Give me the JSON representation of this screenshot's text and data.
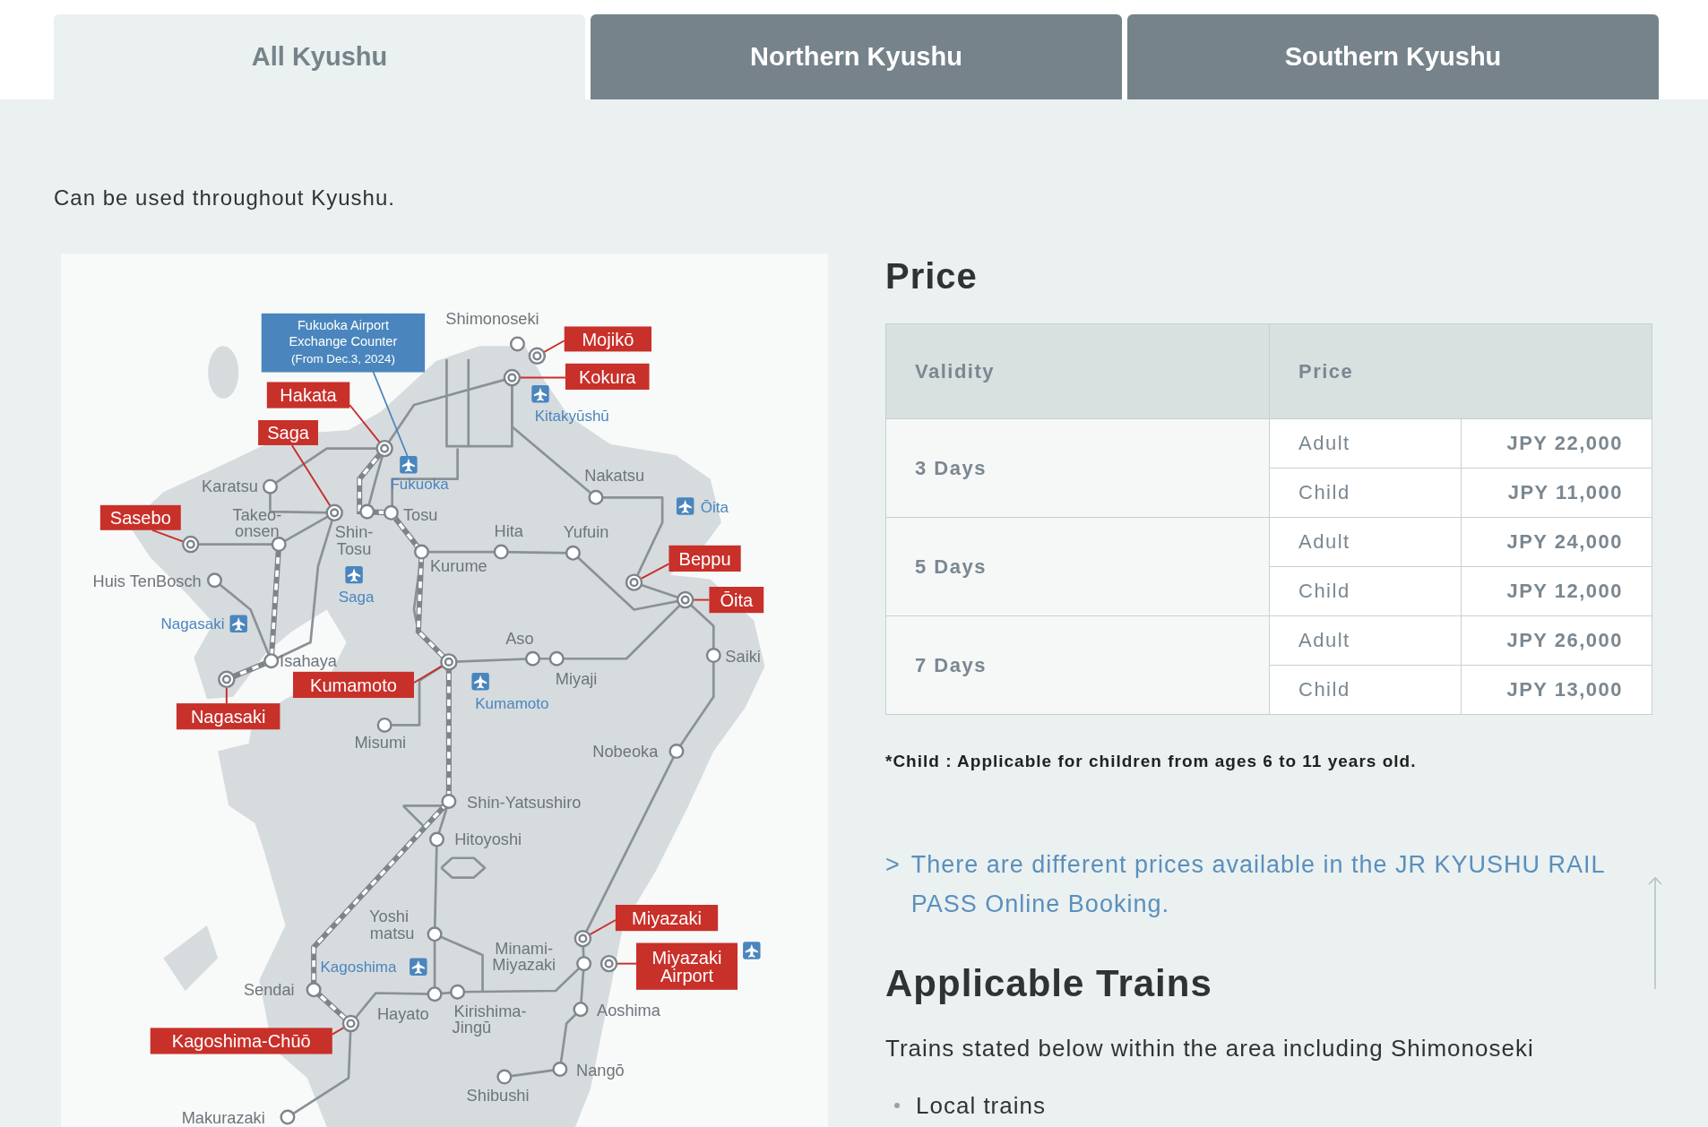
{
  "tabs": [
    {
      "label": "All Kyushu",
      "selected": true
    },
    {
      "label": "Northern Kyushu",
      "selected": false
    },
    {
      "label": "Southern Kyushu",
      "selected": false
    }
  ],
  "intro": "Can be used throughout Kyushu.",
  "map": {
    "callout": {
      "lines": [
        "Fukuoka Airport",
        "Exchange  Counter",
        "(From Dec.3, 2024)"
      ]
    },
    "stations": [
      {
        "kind": "minor",
        "lines": [
          "Shimonoseki"
        ]
      },
      {
        "kind": "major",
        "lines": [
          "Mojikō"
        ]
      },
      {
        "kind": "major",
        "lines": [
          "Kokura"
        ]
      },
      {
        "kind": "major",
        "lines": [
          "Hakata"
        ]
      },
      {
        "kind": "major",
        "lines": [
          "Saga"
        ]
      },
      {
        "kind": "minor",
        "lines": [
          "Karatsu"
        ]
      },
      {
        "kind": "minor",
        "lines": [
          "Nakatsu"
        ]
      },
      {
        "kind": "major",
        "lines": [
          "Sasebo"
        ]
      },
      {
        "kind": "minor",
        "lines": [
          "Takeo-",
          "onsen"
        ]
      },
      {
        "kind": "minor",
        "lines": [
          "Tosu"
        ]
      },
      {
        "kind": "minor",
        "lines": [
          "Shin-",
          "Tosu"
        ]
      },
      {
        "kind": "minor",
        "lines": [
          "Hita"
        ]
      },
      {
        "kind": "minor",
        "lines": [
          "Yufuin"
        ]
      },
      {
        "kind": "major",
        "lines": [
          "Beppu"
        ]
      },
      {
        "kind": "minor",
        "lines": [
          "Huis TenBosch"
        ]
      },
      {
        "kind": "minor",
        "lines": [
          "Kurume"
        ]
      },
      {
        "kind": "major",
        "lines": [
          "Ōita"
        ]
      },
      {
        "kind": "minor",
        "lines": [
          "Aso"
        ]
      },
      {
        "kind": "minor",
        "lines": [
          "Saiki"
        ]
      },
      {
        "kind": "minor",
        "lines": [
          "Isahaya"
        ]
      },
      {
        "kind": "minor",
        "lines": [
          "Miyaji"
        ]
      },
      {
        "kind": "major",
        "lines": [
          "Kumamoto"
        ]
      },
      {
        "kind": "major",
        "lines": [
          "Nagasaki"
        ]
      },
      {
        "kind": "minor",
        "lines": [
          "Misumi"
        ]
      },
      {
        "kind": "minor",
        "lines": [
          "Nobeoka"
        ]
      },
      {
        "kind": "minor",
        "lines": [
          "Shin-Yatsushiro"
        ]
      },
      {
        "kind": "minor",
        "lines": [
          "Hitoyoshi"
        ]
      },
      {
        "kind": "minor",
        "lines": [
          "Yoshi",
          "matsu"
        ]
      },
      {
        "kind": "major",
        "lines": [
          "Miyazaki"
        ]
      },
      {
        "kind": "minor",
        "lines": [
          "Minami-",
          "Miyazaki"
        ]
      },
      {
        "kind": "major",
        "lines": [
          "Miyazaki",
          "Airport"
        ]
      },
      {
        "kind": "minor",
        "lines": [
          "Sendai"
        ]
      },
      {
        "kind": "minor",
        "lines": [
          "Hayato"
        ]
      },
      {
        "kind": "minor",
        "lines": [
          "Kirishima-",
          "Jingū"
        ]
      },
      {
        "kind": "minor",
        "lines": [
          "Aoshima"
        ]
      },
      {
        "kind": "major",
        "lines": [
          "Kagoshima-Chūō"
        ]
      },
      {
        "kind": "minor",
        "lines": [
          "Nangō"
        ]
      },
      {
        "kind": "minor",
        "lines": [
          "Shibushi"
        ]
      },
      {
        "kind": "minor",
        "lines": [
          "Makurazaki"
        ]
      }
    ],
    "airports": [
      {
        "name": "Kitakyūshū"
      },
      {
        "name": "Fukuoka"
      },
      {
        "name": "Ōita"
      },
      {
        "name": "Saga"
      },
      {
        "name": "Nagasaki"
      },
      {
        "name": "Kumamoto"
      },
      {
        "name": "Kagoshima"
      }
    ]
  },
  "price": {
    "title": "Price",
    "columns": [
      "Validity",
      "Price"
    ],
    "rows": [
      {
        "validity": "3 Days",
        "prices": [
          {
            "type": "Adult",
            "amount": "JPY 22,000"
          },
          {
            "type": "Child",
            "amount": "JPY 11,000"
          }
        ]
      },
      {
        "validity": "5 Days",
        "prices": [
          {
            "type": "Adult",
            "amount": "JPY 24,000"
          },
          {
            "type": "Child",
            "amount": "JPY 12,000"
          }
        ]
      },
      {
        "validity": "7 Days",
        "prices": [
          {
            "type": "Adult",
            "amount": "JPY 26,000"
          },
          {
            "type": "Child",
            "amount": "JPY 13,000"
          }
        ]
      }
    ],
    "note": "*Child : Applicable for children from ages 6 to 11 years old."
  },
  "booking_link": {
    "marker": ">",
    "text": "There are different prices available in the JR KYUSHU RAIL PASS Online Booking."
  },
  "applicable_trains": {
    "title": "Applicable Trains",
    "description": "Trains stated below within the area including Shimonoseki",
    "items": [
      "Local trains"
    ]
  }
}
